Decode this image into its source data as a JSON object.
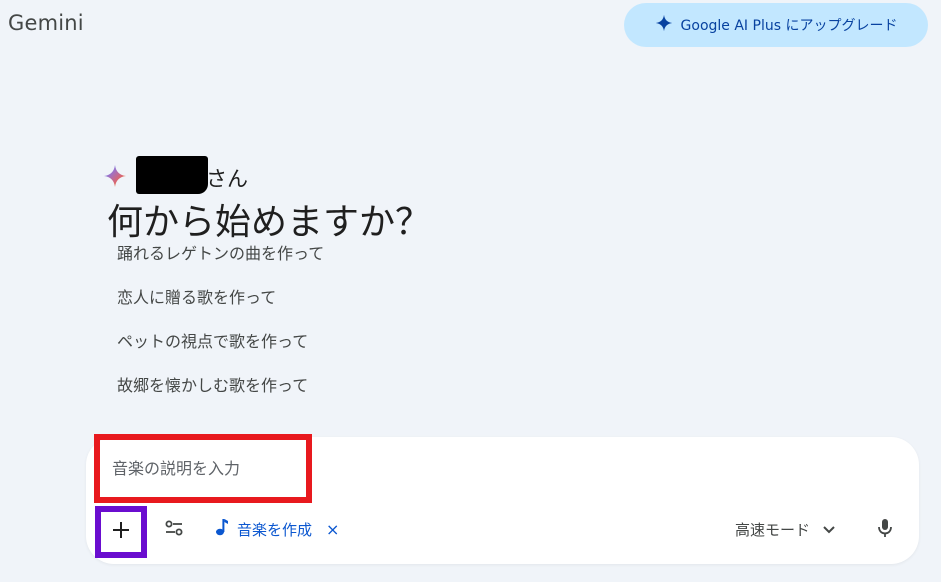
{
  "header": {
    "app_title": "Gemini",
    "upgrade_label": "Google AI Plus にアップグレード"
  },
  "greeting": {
    "suffix": "さん",
    "headline": "何から始めますか？"
  },
  "suggestions": [
    "踊れるレゲトンの曲を作って",
    "恋人に贈る歌を作って",
    "ペットの視点で歌を作って",
    "故郷を懐かしむ歌を作って"
  ],
  "composer": {
    "placeholder": "音楽の説明を入力",
    "chip_label": "音楽を作成",
    "chip_close": "×",
    "mode_label": "高速モード"
  },
  "colors": {
    "background": "#f0f4f9",
    "accent": "#0b57d0",
    "upgrade_bg": "#c2e7ff",
    "highlight_red": "#e8191e",
    "highlight_purple": "#6a0dcf"
  },
  "icons": {
    "upgrade": "sparkle-icon",
    "greeting": "gemini-spark-icon",
    "add": "plus-icon",
    "tools": "tools-sliders-icon",
    "chip": "music-note-icon",
    "mode_dropdown": "chevron-down-icon",
    "voice": "microphone-icon"
  }
}
